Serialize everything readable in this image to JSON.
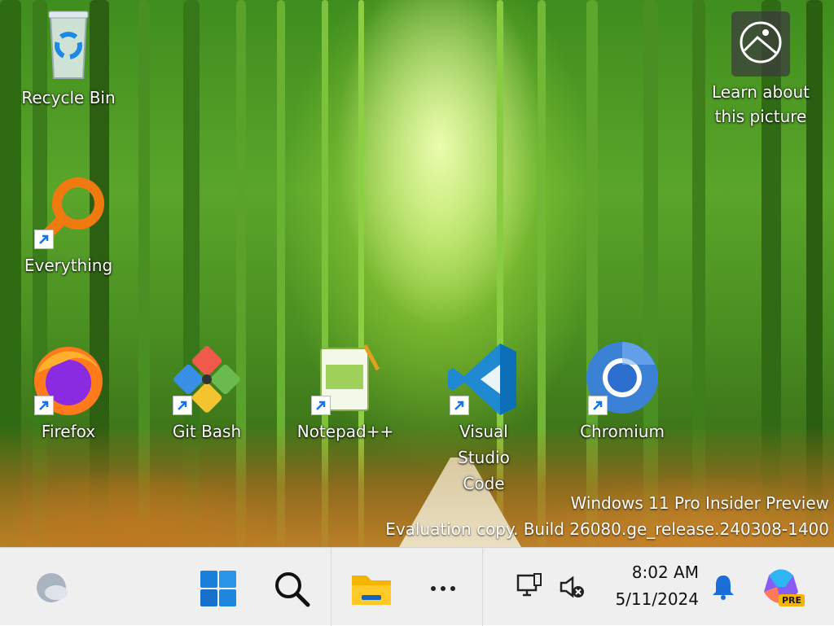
{
  "desktop": {
    "icons": [
      {
        "label": "Recycle Bin"
      },
      {
        "label": "Learn about this picture"
      },
      {
        "label": "Everything"
      },
      {
        "label": "Firefox"
      },
      {
        "label": "Git Bash"
      },
      {
        "label": "Notepad++"
      },
      {
        "label": "Visual Studio Code"
      },
      {
        "label": "Chromium"
      }
    ],
    "watermark": {
      "line1": "Windows 11 Pro Insider Preview",
      "line2": "Evaluation copy. Build 26080.ge_release.240308-1400"
    }
  },
  "taskbar": {
    "clock": {
      "time": "8:02 AM",
      "date": "5/11/2024"
    },
    "copilot_badge": "PRE",
    "items": [
      "weather-icon",
      "start-icon",
      "search-icon",
      "file-explorer-icon",
      "more-icon",
      "network-icon",
      "volume-muted-icon",
      "notification-bell-icon",
      "copilot-icon"
    ],
    "colors": {
      "accent": "#0a6cd6",
      "taskbar_bg": "#efeff0"
    }
  }
}
